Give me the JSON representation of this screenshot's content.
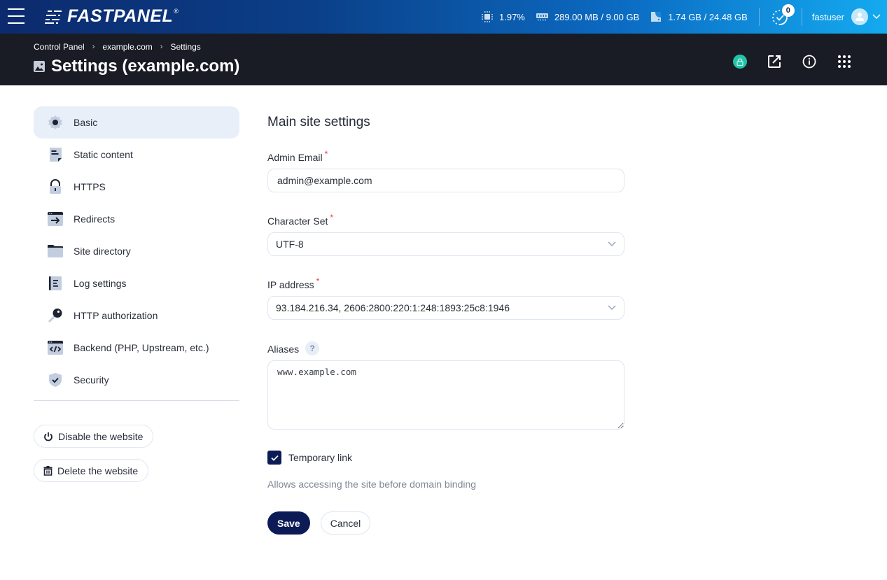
{
  "topbar": {
    "brand": "FASTPANEL",
    "brand_mark": "®",
    "cpu": "1.97%",
    "ram": "289.00 MB / 9.00 GB",
    "disk": "1.74 GB / 24.48 GB",
    "tasks_count": "0",
    "username": "fastuser"
  },
  "header": {
    "breadcrumb": [
      "Control Panel",
      "example.com",
      "Settings"
    ],
    "breadcrumb_separator": "›",
    "title": "Settings (example.com)",
    "ssl_status_color": "#22c3a6"
  },
  "sidebar": {
    "items": [
      {
        "label": "Basic",
        "icon": "gear-icon",
        "active": true
      },
      {
        "label": "Static content",
        "icon": "document-icon",
        "active": false
      },
      {
        "label": "HTTPS",
        "icon": "lock-icon",
        "active": false
      },
      {
        "label": "Redirects",
        "icon": "redirect-icon",
        "active": false
      },
      {
        "label": "Site directory",
        "icon": "folder-icon",
        "active": false
      },
      {
        "label": "Log settings",
        "icon": "log-icon",
        "active": false
      },
      {
        "label": "HTTP authorization",
        "icon": "key-icon",
        "active": false
      },
      {
        "label": "Backend (PHP, Upstream, etc.)",
        "icon": "code-icon",
        "active": false
      },
      {
        "label": "Security",
        "icon": "shield-icon",
        "active": false
      }
    ],
    "disable_label": "Disable the website",
    "delete_label": "Delete the website"
  },
  "form": {
    "section_title": "Main site settings",
    "required_mark": "*",
    "admin_email": {
      "label": "Admin Email",
      "value": "admin@example.com"
    },
    "charset": {
      "label": "Character Set",
      "value": "UTF-8"
    },
    "ip": {
      "label": "IP address",
      "value": "93.184.216.34, 2606:2800:220:1:248:1893:25c8:1946"
    },
    "aliases": {
      "label": "Aliases",
      "help": "?",
      "value": "www.example.com"
    },
    "temporary_link": {
      "label": "Temporary link",
      "checked": true,
      "hint": "Allows accessing the site before domain binding"
    },
    "save_label": "Save",
    "cancel_label": "Cancel"
  },
  "colors": {
    "primary": "#0c1b56",
    "header_bg": "#191c25",
    "active_nav_bg": "#e9eff8",
    "required": "#e6344a"
  }
}
